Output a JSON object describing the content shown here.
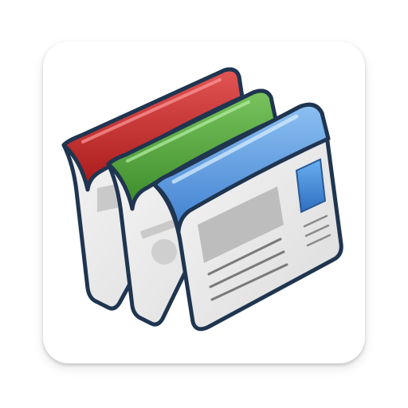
{
  "app_icon": {
    "name": "website-pages-app-icon",
    "colors": {
      "tile_background": "#ffffff",
      "outline": "#1f3550",
      "page_red": "#c62a2a",
      "page_green": "#4f9b3a",
      "page_blue": "#4d8fd6",
      "page_body": "#eeeeee",
      "placeholder_gray": "#bcbcbc"
    },
    "icons": [
      "red-page-icon",
      "green-page-icon",
      "blue-page-icon"
    ]
  }
}
